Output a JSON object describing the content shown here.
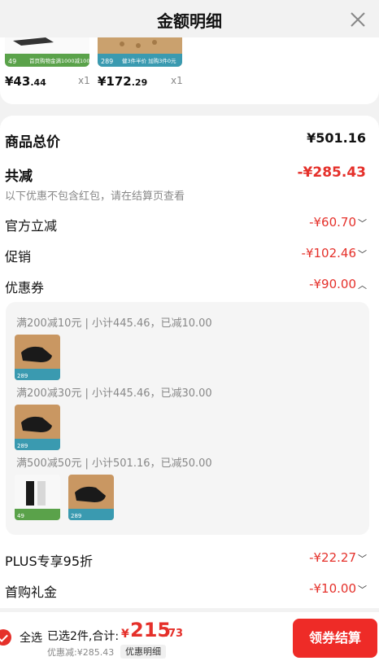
{
  "header": {
    "title": "金额明细"
  },
  "top_products": [
    {
      "banner_text": "首页购物金满1000减100",
      "badge": "49",
      "price_int": "¥43",
      "price_dec": ".44",
      "qty": "x1"
    },
    {
      "banner_text": "健3件半价 | 加购3件0元",
      "badge": "289",
      "price_int": "¥172",
      "price_dec": ".29",
      "qty": "x1"
    }
  ],
  "summary": {
    "total_label": "商品总价",
    "total_value": "¥501.16",
    "discount_label": "共减",
    "discount_value": "-¥285.43",
    "note": "以下优惠不包含红包，请在结算页查看",
    "rows": [
      {
        "label": "官方立减",
        "value": "-¥60.70",
        "chevron": "﹀"
      },
      {
        "label": "促销",
        "value": "-¥102.46",
        "chevron": "﹀"
      },
      {
        "label": "优惠券",
        "value": "-¥90.00",
        "chevron": "︿"
      }
    ],
    "coupons": [
      {
        "text": "满200减10元 | 小计445.46，已减10.00",
        "badge": "289"
      },
      {
        "text": "满200减30元 | 小计445.46，已减30.00",
        "badge": "289"
      },
      {
        "text": "满500减50元 | 小计501.16，已减50.00",
        "badges": [
          "49",
          "289"
        ]
      }
    ],
    "rows_after": [
      {
        "label": "PLUS专享95折",
        "value": "-¥22.27",
        "chevron": "﹀"
      },
      {
        "label": "首购礼金",
        "value": "-¥10.00",
        "chevron": "﹀"
      }
    ]
  },
  "bottom_bar": {
    "select_all": "全选",
    "selected_info": "已选2件,合计:",
    "currency": "¥",
    "sum_int": "215",
    "sum_dec": ".73",
    "save_info": "优惠减:¥285.43",
    "detail_tag": "优惠明细",
    "checkout_label": "领券结算"
  },
  "colors": {
    "accent": "#e5302a",
    "checkout_bg": "#ee2b27",
    "page_bg": "#f2f2f2"
  },
  "icons": {
    "close": "close-icon",
    "check": "check-circle-icon",
    "chevron_down": "chevron-down-icon",
    "chevron_up": "chevron-up-icon"
  }
}
